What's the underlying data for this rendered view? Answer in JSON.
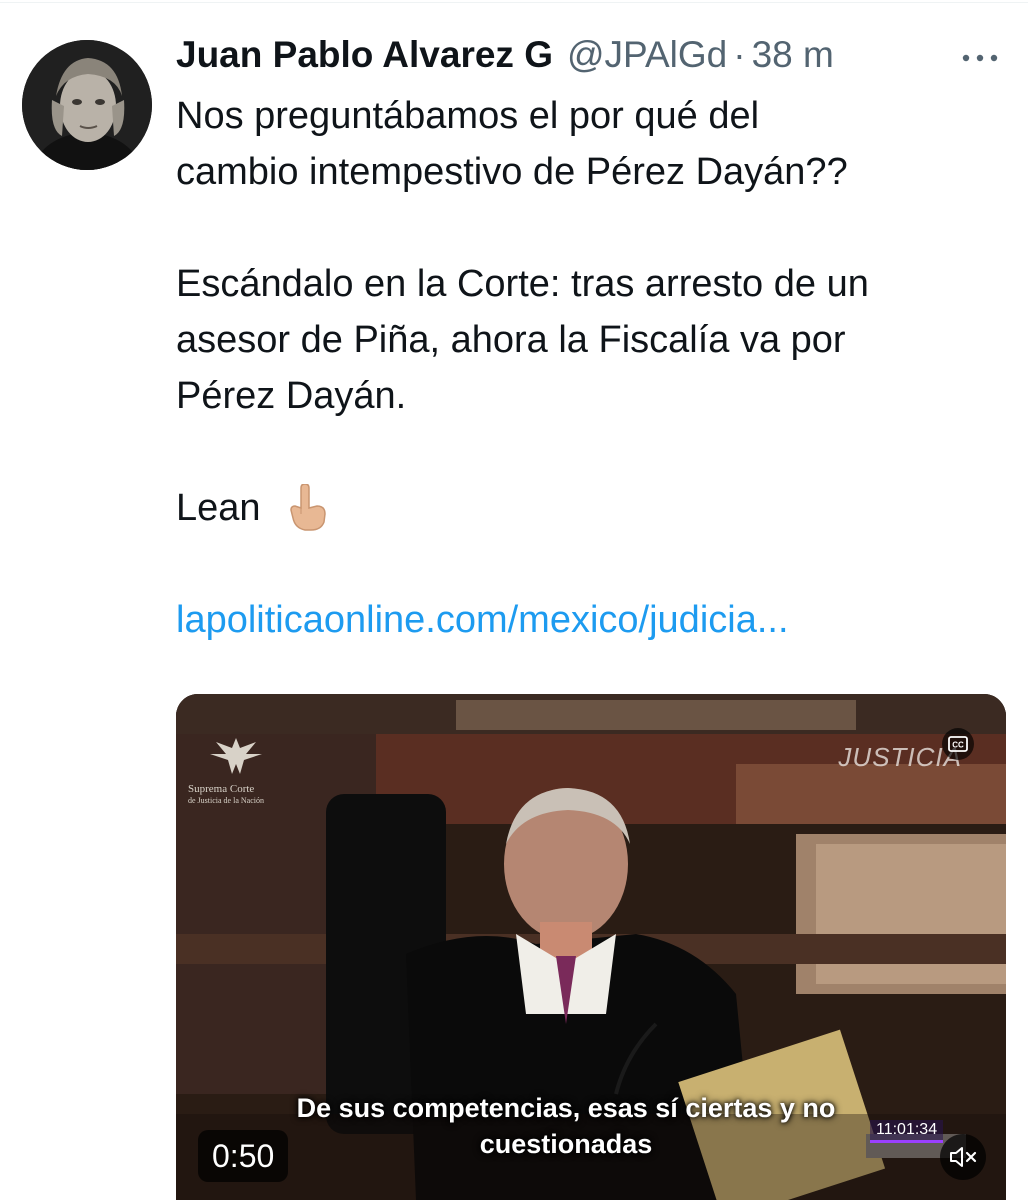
{
  "tweet": {
    "author": {
      "display_name": "Juan Pablo Alvarez G",
      "handle": "@JPAlGd",
      "separator": "·",
      "time": "38 m"
    },
    "more_icon": "ellipsis-icon",
    "text": {
      "paragraph_1": "Nos preguntábamos el por qué del\ncambio intempestivo de Pérez Dayán??",
      "paragraph_2": "Escándalo en la Corte: tras arresto de un\nasesor de Piña, ahora la Fiscalía va por\nPérez Dayán.",
      "paragraph_3": "Lean",
      "emoji": "backhand-index-pointing-down",
      "link": "lapoliticaonline.com/mexico/judicia..."
    },
    "link_color": "#1d9bf0",
    "video": {
      "logo_left_lines": [
        "Suprema Corte",
        "de Justicia de la Nación"
      ],
      "logo_right": "JUSTICIA",
      "cc_icon": "closed-captions-icon",
      "subtitle_lines": [
        "De sus competencias, esas sí ciertas y no",
        "cuestionadas"
      ],
      "on_screen_clock": "11:01:34",
      "duration": "0:50",
      "mute_icon": "volume-muted-icon"
    }
  }
}
